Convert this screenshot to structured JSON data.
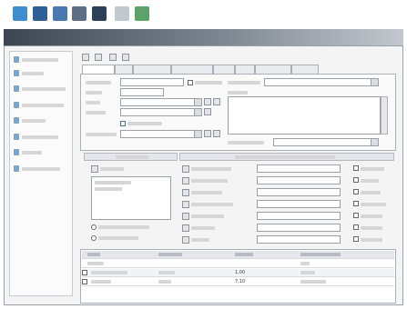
{
  "window": {
    "title": ""
  },
  "status": {
    "checked_flag": ""
  },
  "grid": {
    "rows": [
      {
        "c3": "1,00"
      },
      {
        "c3": "7,10"
      }
    ]
  }
}
